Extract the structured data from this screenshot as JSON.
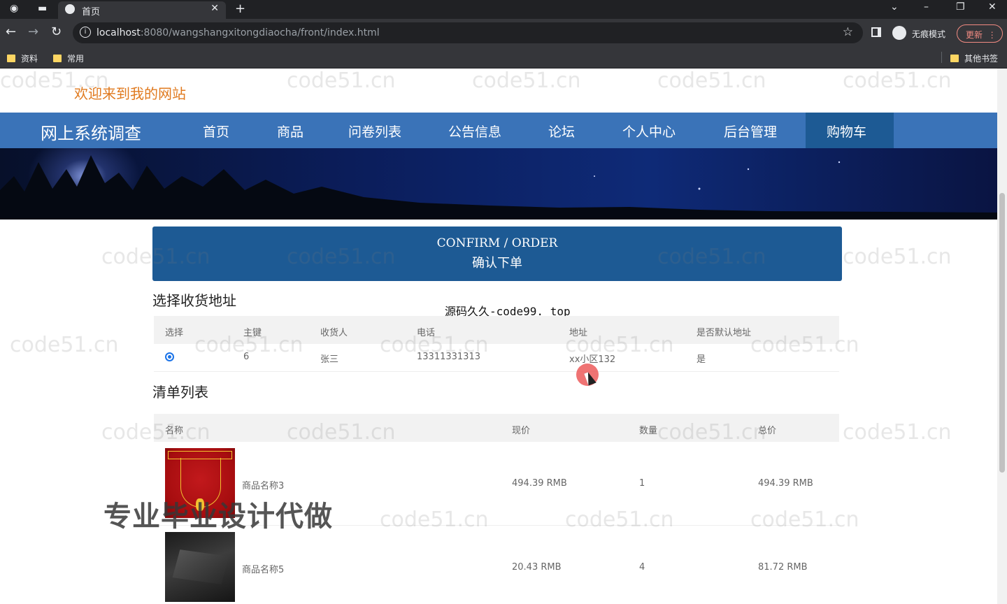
{
  "browser": {
    "tab_title": "首页",
    "url_host": "localhost",
    "url_rest": ":8080/wangshangxitongdiaocha/front/index.html",
    "incognito_label": "无痕模式",
    "update_label": "更新",
    "bookmarks": [
      "资料",
      "常用"
    ],
    "other_bookmarks": "其他书签"
  },
  "site": {
    "welcome": "欢迎来到我的网站",
    "brand": "网上系统调查",
    "nav": [
      "首页",
      "商品",
      "问卷列表",
      "公告信息",
      "论坛",
      "个人中心",
      "后台管理",
      "购物车"
    ],
    "active_nav": "购物车"
  },
  "confirm": {
    "title_en": "CONFIRM / ORDER",
    "title_zh": "确认下单"
  },
  "address_section": {
    "title": "选择收货地址",
    "headers": [
      "选择",
      "主键",
      "收货人",
      "电话",
      "地址",
      "是否默认地址"
    ],
    "rows": [
      {
        "selected": true,
        "id": "6",
        "name": "张三",
        "phone": "13311331313",
        "address": "xx小区132",
        "is_default": "是"
      }
    ]
  },
  "items_section": {
    "title": "清单列表",
    "headers": [
      "名称",
      "现价",
      "数量",
      "总价"
    ],
    "rows": [
      {
        "name": "商品名称3",
        "price": "494.39 RMB",
        "qty": "1",
        "total": "494.39 RMB"
      },
      {
        "name": "商品名称5",
        "price": "20.43 RMB",
        "qty": "4",
        "total": "81.72 RMB"
      }
    ]
  },
  "overlays": {
    "source_text": "源码久久-code99. top",
    "promo_text": "专业毕业设计代做",
    "watermark": "code51.cn"
  },
  "colors": {
    "nav_bg": "#3a73b8",
    "nav_active": "#1d5a94",
    "welcome_text": "#e07a1f"
  }
}
